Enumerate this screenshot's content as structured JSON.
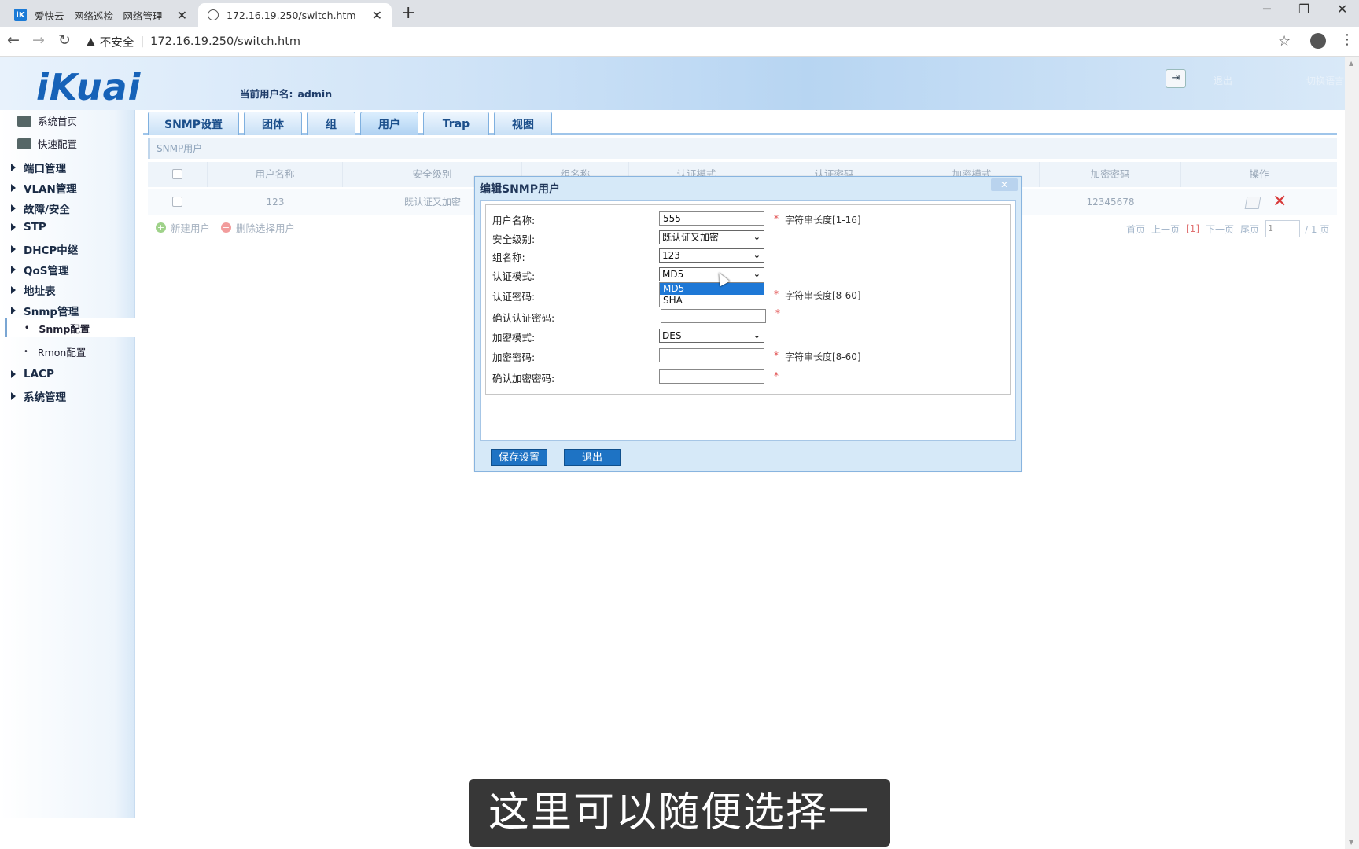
{
  "browser": {
    "tabs": [
      {
        "title": "爱快云 - 网络巡检 - 网络管理",
        "close": "✕"
      },
      {
        "title": "172.16.19.250/switch.htm",
        "close": "✕"
      }
    ],
    "new_tab": "+",
    "security": "不安全",
    "url": "172.16.19.250/switch.htm",
    "window": {
      "min": "─",
      "max": "❐",
      "close": "✕"
    }
  },
  "header": {
    "logo": "iKuai",
    "current_user_label": "当前用户名:",
    "current_user": "admin",
    "logout": "退出",
    "switch_lang": "切换语言"
  },
  "sidebar": {
    "top": [
      {
        "label": "系统首页",
        "icon": "home-icon"
      },
      {
        "label": "快速配置",
        "icon": "quick-config-icon"
      }
    ],
    "groups": [
      {
        "label": "端口管理"
      },
      {
        "label": "VLAN管理"
      },
      {
        "label": "故障/安全"
      },
      {
        "label": "STP"
      },
      {
        "label": "DHCP中继"
      },
      {
        "label": "QoS管理"
      },
      {
        "label": "地址表"
      },
      {
        "label": "Snmp管理"
      }
    ],
    "sub": [
      {
        "label": "Snmp配置",
        "active": true
      },
      {
        "label": "Rmon配置",
        "active": false
      }
    ],
    "groups2": [
      {
        "label": "LACP"
      },
      {
        "label": "系统管理"
      }
    ]
  },
  "main": {
    "tabs": [
      "SNMP设置",
      "团体",
      "组",
      "用户",
      "Trap",
      "视图"
    ],
    "active_tab": "用户",
    "section_title": "SNMP用户",
    "columns": [
      "用户名称",
      "安全级别",
      "组名称",
      "认证模式",
      "认证密码",
      "加密模式",
      "加密密码",
      "操作"
    ],
    "row": {
      "name": "123",
      "level": "既认证又加密",
      "enc_pwd": "12345678"
    },
    "actions": {
      "new": "新建用户",
      "delete": "删除选择用户"
    },
    "pager": {
      "first": "首页",
      "prev": "上一页",
      "current": "[1]",
      "next": "下一页",
      "last": "尾页",
      "input": "1",
      "total": "/ 1 页"
    }
  },
  "modal": {
    "title": "编辑SNMP用户",
    "close": "✕",
    "fields": {
      "username": {
        "label": "用户名称:",
        "value": "555",
        "hint": "字符串长度[1-16]"
      },
      "level": {
        "label": "安全级别:",
        "value": "既认证又加密"
      },
      "group": {
        "label": "组名称:",
        "value": "123"
      },
      "auth_mode": {
        "label": "认证模式:",
        "value": "MD5",
        "options": [
          "MD5",
          "SHA"
        ]
      },
      "auth_pwd": {
        "label": "认证密码:",
        "hint": "字符串长度[8-60]"
      },
      "auth_pwd_confirm": {
        "label": "确认认证密码:"
      },
      "enc_mode": {
        "label": "加密模式:",
        "value": "DES"
      },
      "enc_pwd": {
        "label": "加密密码:",
        "hint": "字符串长度[8-60]"
      },
      "enc_pwd_confirm": {
        "label": "确认加密密码:"
      }
    },
    "required": "*",
    "save": "保存设置",
    "cancel": "退出"
  },
  "subtitle": "这里可以随便选择一个"
}
